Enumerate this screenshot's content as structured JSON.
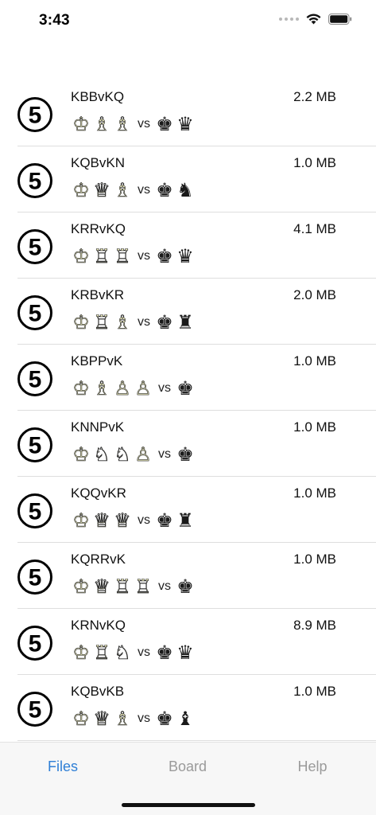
{
  "status_bar": {
    "time": "3:43"
  },
  "files": [
    {
      "number": "5",
      "name": "KBBvKQ",
      "size": "2.2 MB",
      "white": [
        "K",
        "B",
        "B"
      ],
      "black": [
        "K",
        "Q"
      ]
    },
    {
      "number": "5",
      "name": "KQBvKN",
      "size": "1.0 MB",
      "white": [
        "K",
        "Q",
        "B"
      ],
      "black": [
        "K",
        "N"
      ]
    },
    {
      "number": "5",
      "name": "KRRvKQ",
      "size": "4.1 MB",
      "white": [
        "K",
        "R",
        "R"
      ],
      "black": [
        "K",
        "Q"
      ]
    },
    {
      "number": "5",
      "name": "KRBvKR",
      "size": "2.0 MB",
      "white": [
        "K",
        "R",
        "B"
      ],
      "black": [
        "K",
        "R"
      ]
    },
    {
      "number": "5",
      "name": "KBPPvK",
      "size": "1.0 MB",
      "white": [
        "K",
        "B",
        "P",
        "P"
      ],
      "black": [
        "K"
      ]
    },
    {
      "number": "5",
      "name": "KNNPvK",
      "size": "1.0 MB",
      "white": [
        "K",
        "N",
        "N",
        "P"
      ],
      "black": [
        "K"
      ]
    },
    {
      "number": "5",
      "name": "KQQvKR",
      "size": "1.0 MB",
      "white": [
        "K",
        "Q",
        "Q"
      ],
      "black": [
        "K",
        "R"
      ]
    },
    {
      "number": "5",
      "name": "KQRRvK",
      "size": "1.0 MB",
      "white": [
        "K",
        "Q",
        "R",
        "R"
      ],
      "black": [
        "K"
      ]
    },
    {
      "number": "5",
      "name": "KRNvKQ",
      "size": "8.9 MB",
      "white": [
        "K",
        "R",
        "N"
      ],
      "black": [
        "K",
        "Q"
      ]
    },
    {
      "number": "5",
      "name": "KQBvKB",
      "size": "1.0 MB",
      "white": [
        "K",
        "Q",
        "B"
      ],
      "black": [
        "K",
        "B"
      ]
    }
  ],
  "vs_label": "vs",
  "tabs": [
    {
      "id": "files",
      "label": "Files",
      "active": true
    },
    {
      "id": "board",
      "label": "Board",
      "active": false
    },
    {
      "id": "help",
      "label": "Help",
      "active": false
    }
  ],
  "colors": {
    "accent": "#2f7fd6",
    "inactive_tab": "#9a9a9a",
    "white_piece_fill": "#ecebbd",
    "black_piece_fill": "#1a1a1a"
  },
  "icons": {
    "status": [
      "cellular-signal-icon",
      "wifi-icon",
      "battery-icon"
    ],
    "row_badge": "circled-number-icon"
  }
}
